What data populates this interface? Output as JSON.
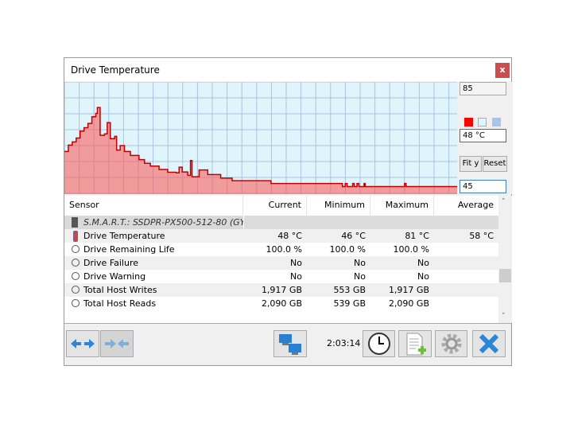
{
  "window": {
    "title": "Drive Temperature",
    "close_label": "x"
  },
  "graph_panel": {
    "max_value": "85",
    "current_value": "48 °C",
    "min_value": "45",
    "fit_label": "Fit y",
    "reset_label": "Reset",
    "colors": {
      "line": "#ff0000",
      "background": "#dff5fb",
      "grid": "#a9c4e4"
    }
  },
  "chart_data": {
    "type": "area",
    "title": "Drive Temperature",
    "ylim": [
      45,
      85
    ],
    "xlabel": "",
    "ylabel": "°C",
    "grid": true,
    "x_unit": "percent of history",
    "points": [
      [
        0,
        60.2
      ],
      [
        1,
        62.5
      ],
      [
        2,
        63.6
      ],
      [
        3,
        65
      ],
      [
        4,
        67.5
      ],
      [
        5,
        68.7
      ],
      [
        6,
        70.2
      ],
      [
        7,
        72.6
      ],
      [
        8,
        73.8
      ],
      [
        8.4,
        75.9
      ],
      [
        9.1,
        66
      ],
      [
        10.2,
        66.5
      ],
      [
        10.9,
        70.5
      ],
      [
        11.7,
        64.8
      ],
      [
        12.8,
        65.6
      ],
      [
        13.3,
        60.7
      ],
      [
        14.2,
        62.3
      ],
      [
        15.3,
        60.2
      ],
      [
        16.8,
        58.8
      ],
      [
        19,
        57.3
      ],
      [
        20.4,
        56
      ],
      [
        21.9,
        55
      ],
      [
        24.1,
        53.8
      ],
      [
        26.3,
        52.8
      ],
      [
        28.5,
        52.6
      ],
      [
        29.2,
        54.6
      ],
      [
        30,
        52.9
      ],
      [
        31.4,
        51.7
      ],
      [
        32.1,
        57
      ],
      [
        32.5,
        51.2
      ],
      [
        34.3,
        53.6
      ],
      [
        36.5,
        52
      ],
      [
        39.8,
        50.7
      ],
      [
        42.7,
        49.8
      ],
      [
        52.6,
        48.8
      ],
      [
        70.8,
        47.7
      ],
      [
        71.5,
        48.8
      ],
      [
        72,
        47.7
      ],
      [
        73.4,
        48.8
      ],
      [
        73.8,
        47.7
      ],
      [
        74.5,
        48.8
      ],
      [
        75,
        47.7
      ],
      [
        76.3,
        48.8
      ],
      [
        76.6,
        47.7
      ],
      [
        86.6,
        48.8
      ],
      [
        87,
        47.7
      ],
      [
        100,
        47.7
      ]
    ]
  },
  "table": {
    "headers": [
      "Sensor",
      "Current",
      "Minimum",
      "Maximum",
      "Average"
    ],
    "group": "S.M.A.R.T.: SSDPR-PX500-512-80 (GY...",
    "rows": [
      {
        "name": "Drive Temperature",
        "icon": "thermometer",
        "current": "48 °C",
        "minimum": "46 °C",
        "maximum": "81 °C",
        "average": "58 °C"
      },
      {
        "name": "Drive Remaining Life",
        "icon": "clock",
        "current": "100.0 %",
        "minimum": "100.0 %",
        "maximum": "100.0 %",
        "average": ""
      },
      {
        "name": "Drive Failure",
        "icon": "clock",
        "current": "No",
        "minimum": "No",
        "maximum": "No",
        "average": ""
      },
      {
        "name": "Drive Warning",
        "icon": "clock",
        "current": "No",
        "minimum": "No",
        "maximum": "No",
        "average": ""
      },
      {
        "name": "Total Host Writes",
        "icon": "clock",
        "current": "1,917 GB",
        "minimum": "553 GB",
        "maximum": "1,917 GB",
        "average": ""
      },
      {
        "name": "Total Host Reads",
        "icon": "clock",
        "current": "2,090 GB",
        "minimum": "539 GB",
        "maximum": "2,090 GB",
        "average": ""
      }
    ]
  },
  "toolbar": {
    "elapsed": "2:03:14"
  }
}
